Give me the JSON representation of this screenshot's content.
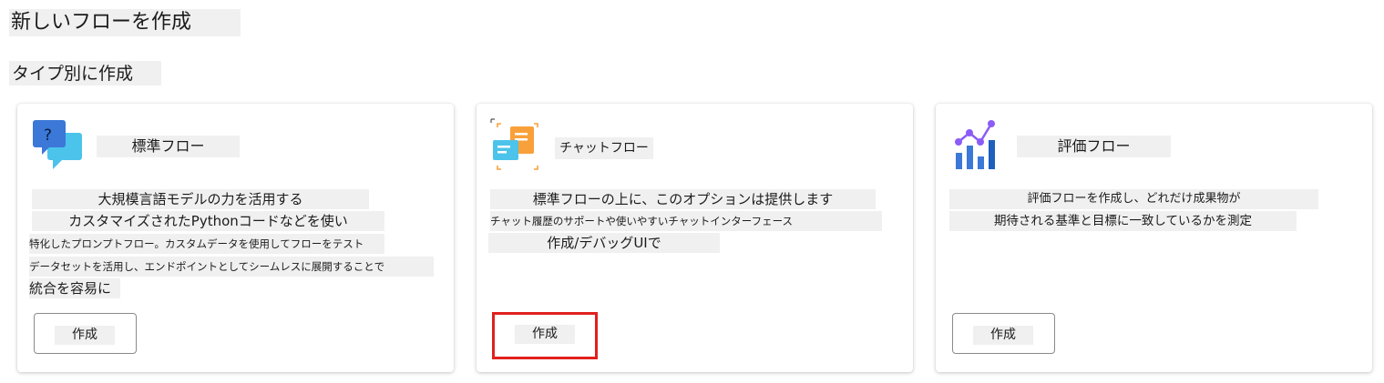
{
  "page": {
    "title": "新しいフローを作成",
    "section_title": "タイプ別に作成"
  },
  "cards": {
    "standard": {
      "title": "標準フロー",
      "icon": "chat-bubbles-question-icon",
      "description": [
        "大規模言語モデルの力を活用する",
        "カスタマイズされたPythonコードなどを使い",
        "特化したプロンプトフロー。カスタムデータを使用してフローをテスト",
        "データセットを活用し、エンドポイントとしてシームレスに展開することで",
        "統合を容易に"
      ],
      "button_label": "作成"
    },
    "chat": {
      "title": "チャットフロー",
      "icon": "chat-window-icon",
      "description": [
        "標準フローの上に、このオプションは提供します",
        "チャット履歴のサポートや使いやすいチャットインターフェース",
        "作成/デバッグUIで"
      ],
      "button_label": "作成"
    },
    "evaluation": {
      "title": "評価フロー",
      "icon": "evaluation-chart-icon",
      "description": [
        "評価フローを作成し、どれだけ成果物が",
        "期待される基準と目標に一致しているかを測定"
      ],
      "button_label": "作成"
    }
  },
  "colors": {
    "highlight_border": "#e0201e",
    "text_background": "#f0f0f0",
    "icon_blue": "#3b78d8",
    "icon_cyan": "#4cc3ea",
    "icon_orange": "#f8a13a",
    "icon_purple": "#8b5cf6"
  }
}
